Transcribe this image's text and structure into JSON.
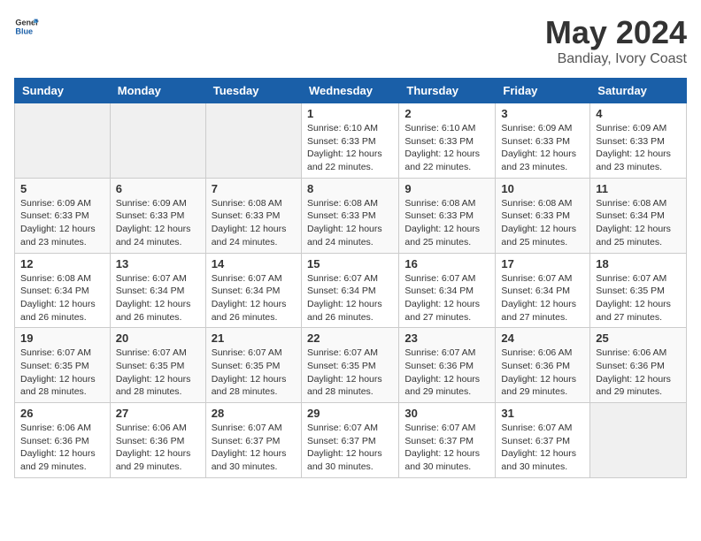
{
  "header": {
    "logo_general": "General",
    "logo_blue": "Blue",
    "month_title": "May 2024",
    "location": "Bandiay, Ivory Coast"
  },
  "weekdays": [
    "Sunday",
    "Monday",
    "Tuesday",
    "Wednesday",
    "Thursday",
    "Friday",
    "Saturday"
  ],
  "weeks": [
    [
      {
        "day": "",
        "info": ""
      },
      {
        "day": "",
        "info": ""
      },
      {
        "day": "",
        "info": ""
      },
      {
        "day": "1",
        "info": "Sunrise: 6:10 AM\nSunset: 6:33 PM\nDaylight: 12 hours\nand 22 minutes."
      },
      {
        "day": "2",
        "info": "Sunrise: 6:10 AM\nSunset: 6:33 PM\nDaylight: 12 hours\nand 22 minutes."
      },
      {
        "day": "3",
        "info": "Sunrise: 6:09 AM\nSunset: 6:33 PM\nDaylight: 12 hours\nand 23 minutes."
      },
      {
        "day": "4",
        "info": "Sunrise: 6:09 AM\nSunset: 6:33 PM\nDaylight: 12 hours\nand 23 minutes."
      }
    ],
    [
      {
        "day": "5",
        "info": "Sunrise: 6:09 AM\nSunset: 6:33 PM\nDaylight: 12 hours\nand 23 minutes."
      },
      {
        "day": "6",
        "info": "Sunrise: 6:09 AM\nSunset: 6:33 PM\nDaylight: 12 hours\nand 24 minutes."
      },
      {
        "day": "7",
        "info": "Sunrise: 6:08 AM\nSunset: 6:33 PM\nDaylight: 12 hours\nand 24 minutes."
      },
      {
        "day": "8",
        "info": "Sunrise: 6:08 AM\nSunset: 6:33 PM\nDaylight: 12 hours\nand 24 minutes."
      },
      {
        "day": "9",
        "info": "Sunrise: 6:08 AM\nSunset: 6:33 PM\nDaylight: 12 hours\nand 25 minutes."
      },
      {
        "day": "10",
        "info": "Sunrise: 6:08 AM\nSunset: 6:33 PM\nDaylight: 12 hours\nand 25 minutes."
      },
      {
        "day": "11",
        "info": "Sunrise: 6:08 AM\nSunset: 6:34 PM\nDaylight: 12 hours\nand 25 minutes."
      }
    ],
    [
      {
        "day": "12",
        "info": "Sunrise: 6:08 AM\nSunset: 6:34 PM\nDaylight: 12 hours\nand 26 minutes."
      },
      {
        "day": "13",
        "info": "Sunrise: 6:07 AM\nSunset: 6:34 PM\nDaylight: 12 hours\nand 26 minutes."
      },
      {
        "day": "14",
        "info": "Sunrise: 6:07 AM\nSunset: 6:34 PM\nDaylight: 12 hours\nand 26 minutes."
      },
      {
        "day": "15",
        "info": "Sunrise: 6:07 AM\nSunset: 6:34 PM\nDaylight: 12 hours\nand 26 minutes."
      },
      {
        "day": "16",
        "info": "Sunrise: 6:07 AM\nSunset: 6:34 PM\nDaylight: 12 hours\nand 27 minutes."
      },
      {
        "day": "17",
        "info": "Sunrise: 6:07 AM\nSunset: 6:34 PM\nDaylight: 12 hours\nand 27 minutes."
      },
      {
        "day": "18",
        "info": "Sunrise: 6:07 AM\nSunset: 6:35 PM\nDaylight: 12 hours\nand 27 minutes."
      }
    ],
    [
      {
        "day": "19",
        "info": "Sunrise: 6:07 AM\nSunset: 6:35 PM\nDaylight: 12 hours\nand 28 minutes."
      },
      {
        "day": "20",
        "info": "Sunrise: 6:07 AM\nSunset: 6:35 PM\nDaylight: 12 hours\nand 28 minutes."
      },
      {
        "day": "21",
        "info": "Sunrise: 6:07 AM\nSunset: 6:35 PM\nDaylight: 12 hours\nand 28 minutes."
      },
      {
        "day": "22",
        "info": "Sunrise: 6:07 AM\nSunset: 6:35 PM\nDaylight: 12 hours\nand 28 minutes."
      },
      {
        "day": "23",
        "info": "Sunrise: 6:07 AM\nSunset: 6:36 PM\nDaylight: 12 hours\nand 29 minutes."
      },
      {
        "day": "24",
        "info": "Sunrise: 6:06 AM\nSunset: 6:36 PM\nDaylight: 12 hours\nand 29 minutes."
      },
      {
        "day": "25",
        "info": "Sunrise: 6:06 AM\nSunset: 6:36 PM\nDaylight: 12 hours\nand 29 minutes."
      }
    ],
    [
      {
        "day": "26",
        "info": "Sunrise: 6:06 AM\nSunset: 6:36 PM\nDaylight: 12 hours\nand 29 minutes."
      },
      {
        "day": "27",
        "info": "Sunrise: 6:06 AM\nSunset: 6:36 PM\nDaylight: 12 hours\nand 29 minutes."
      },
      {
        "day": "28",
        "info": "Sunrise: 6:07 AM\nSunset: 6:37 PM\nDaylight: 12 hours\nand 30 minutes."
      },
      {
        "day": "29",
        "info": "Sunrise: 6:07 AM\nSunset: 6:37 PM\nDaylight: 12 hours\nand 30 minutes."
      },
      {
        "day": "30",
        "info": "Sunrise: 6:07 AM\nSunset: 6:37 PM\nDaylight: 12 hours\nand 30 minutes."
      },
      {
        "day": "31",
        "info": "Sunrise: 6:07 AM\nSunset: 6:37 PM\nDaylight: 12 hours\nand 30 minutes."
      },
      {
        "day": "",
        "info": ""
      }
    ]
  ]
}
